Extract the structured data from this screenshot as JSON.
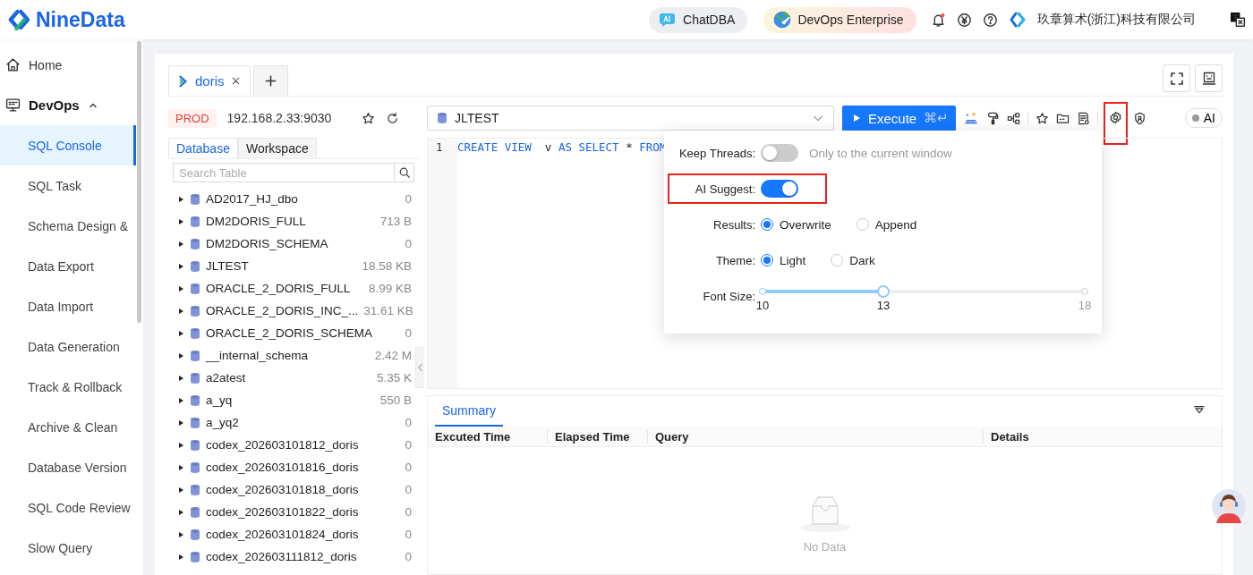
{
  "header": {
    "brand": "NineData",
    "chat_button": "ChatDBA",
    "edition_button": "DevOps Enterprise",
    "notifications_unread": true,
    "company": "玖章算术(浙江)科技有限公司"
  },
  "sidebar": {
    "items": [
      {
        "label": "Home"
      },
      {
        "label": "DevOps",
        "expanded": true,
        "children": [
          {
            "label": "SQL Console",
            "selected": true
          },
          {
            "label": "SQL Task",
            "selected": false
          },
          {
            "label": "Schema Design &",
            "selected": false
          },
          {
            "label": "Data Export",
            "selected": false
          },
          {
            "label": "Data Import",
            "selected": false
          },
          {
            "label": "Data Generation",
            "selected": false
          },
          {
            "label": "Track & Rollback",
            "selected": false
          },
          {
            "label": "Archive & Clean",
            "selected": false
          },
          {
            "label": "Database Version",
            "selected": false
          },
          {
            "label": "SQL Code Review",
            "selected": false
          },
          {
            "label": "Slow Query",
            "selected": false
          }
        ]
      }
    ]
  },
  "editor_tabs": [
    {
      "label": "doris",
      "selected": true
    }
  ],
  "connection": {
    "env": "PROD",
    "address": "192.168.2.33:9030"
  },
  "panel_tabs": [
    {
      "label": "Database",
      "selected": true
    },
    {
      "label": "Workspace",
      "selected": false
    }
  ],
  "search": {
    "placeholder": "Search Table"
  },
  "tree": [
    {
      "name": "AD2017_HJ_dbo",
      "size": "0",
      "expanded": false
    },
    {
      "name": "DM2DORIS_FULL",
      "size": "713 B",
      "expanded": false
    },
    {
      "name": "DM2DORIS_SCHEMA",
      "size": "0",
      "expanded": false
    },
    {
      "name": "JLTEST",
      "size": "18.58 KB",
      "expanded": false
    },
    {
      "name": "ORACLE_2_DORIS_FULL",
      "size": "8.99 KB",
      "expanded": false
    },
    {
      "name": "ORACLE_2_DORIS_INC_...",
      "size": "31.61 KB",
      "expanded": false
    },
    {
      "name": "ORACLE_2_DORIS_SCHEMA",
      "size": "0",
      "expanded": false
    },
    {
      "name": "__internal_schema",
      "size": "2.42 M",
      "expanded": false
    },
    {
      "name": "a2atest",
      "size": "5.35 K",
      "expanded": false
    },
    {
      "name": "a_yq",
      "size": "550 B",
      "expanded": false
    },
    {
      "name": "a_yq2",
      "size": "0",
      "expanded": false
    },
    {
      "name": "codex_202603101812_doris",
      "size": "0",
      "expanded": false
    },
    {
      "name": "codex_202603101816_doris",
      "size": "0",
      "expanded": false
    },
    {
      "name": "codex_202603101818_doris",
      "size": "0",
      "expanded": false
    },
    {
      "name": "codex_202603101822_doris",
      "size": "0",
      "expanded": false
    },
    {
      "name": "codex_202603101824_doris",
      "size": "0",
      "expanded": false
    },
    {
      "name": "codex_202603111812_doris",
      "size": "0",
      "expanded": false
    }
  ],
  "toolbar": {
    "database": "JLTEST",
    "execute": "Execute",
    "shortcut": "⌘↵",
    "settings_highlighted": true,
    "ai_toggle": {
      "label": "AI",
      "on": false
    }
  },
  "editor": {
    "lines": [
      {
        "number": "1",
        "tokens": [
          {
            "text": "CREATE VIEW ",
            "kind": "keyword"
          },
          {
            "text": " v ",
            "kind": "plain"
          },
          {
            "text": "AS SELECT",
            "kind": "keyword"
          },
          {
            "text": " * ",
            "kind": "plain"
          },
          {
            "text": "FROM",
            "kind": "keyword"
          }
        ]
      }
    ]
  },
  "settings": {
    "rows": [
      {
        "kind": "toggle",
        "label": "Keep Threads:",
        "on": false,
        "hint": "Only to the current window",
        "highlighted": false
      },
      {
        "kind": "toggle",
        "label": "AI Suggest:",
        "on": true,
        "highlighted": true
      },
      {
        "kind": "radio",
        "label": "Results:",
        "options": [
          {
            "label": "Overwrite",
            "selected": true
          },
          {
            "label": "Append",
            "selected": false
          }
        ]
      },
      {
        "kind": "radio",
        "label": "Theme:",
        "options": [
          {
            "label": "Light",
            "selected": true
          },
          {
            "label": "Dark",
            "selected": false
          }
        ]
      },
      {
        "kind": "slider",
        "label": "Font Size:",
        "level": 0.375,
        "min": "10",
        "value": "13",
        "max": "18"
      }
    ]
  },
  "results": {
    "tabs": [
      {
        "label": "Summary",
        "selected": true
      }
    ],
    "columns": [
      "Excuted Time",
      "Elapsed Time",
      "Query",
      "Details"
    ],
    "empty": "No Data"
  }
}
